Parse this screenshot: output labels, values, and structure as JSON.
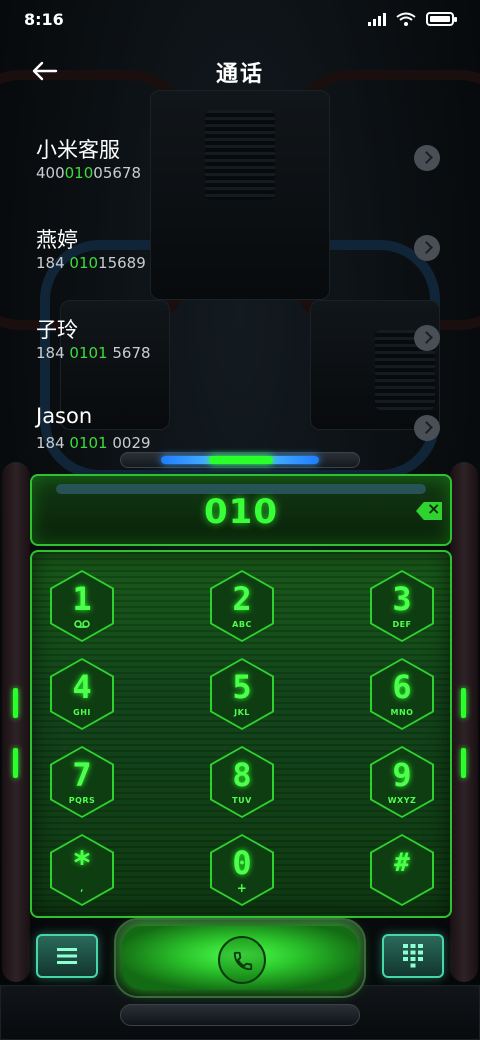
{
  "status_bar": {
    "time": "8:16"
  },
  "header": {
    "title": "通话"
  },
  "calls": [
    {
      "name": "小米客服",
      "number_pre": "400",
      "number_hl": "010",
      "number_post": "05678"
    },
    {
      "name": "燕婷",
      "number_pre": "184 ",
      "number_hl": "010",
      "number_post": "15689"
    },
    {
      "name": "子玲",
      "number_pre": "184 ",
      "number_hl": "0101",
      "number_post": " 5678"
    },
    {
      "name": "Jason",
      "number_pre": "184 ",
      "number_hl": "0101",
      "number_post": " 0029"
    }
  ],
  "dialer": {
    "input": "010",
    "keys": [
      {
        "d": "1",
        "s": ""
      },
      {
        "d": "2",
        "s": "ABC"
      },
      {
        "d": "3",
        "s": "DEF"
      },
      {
        "d": "4",
        "s": "GHI"
      },
      {
        "d": "5",
        "s": "JKL"
      },
      {
        "d": "6",
        "s": "MNO"
      },
      {
        "d": "7",
        "s": "PQRS"
      },
      {
        "d": "8",
        "s": "TUV"
      },
      {
        "d": "9",
        "s": "WXYZ"
      },
      {
        "d": "*",
        "s": ","
      },
      {
        "d": "0",
        "s": "+"
      },
      {
        "d": "#",
        "s": ""
      }
    ]
  },
  "icons": {
    "back": "arrow-left-icon",
    "chevron": "chevron-right-icon",
    "delete": "backspace-icon",
    "menu": "menu-icon",
    "call": "phone-icon",
    "keypad": "keypad-icon",
    "voicemail": "voicemail-icon"
  },
  "colors": {
    "accent": "#3ddc3d",
    "frame": "#2ec22e"
  }
}
